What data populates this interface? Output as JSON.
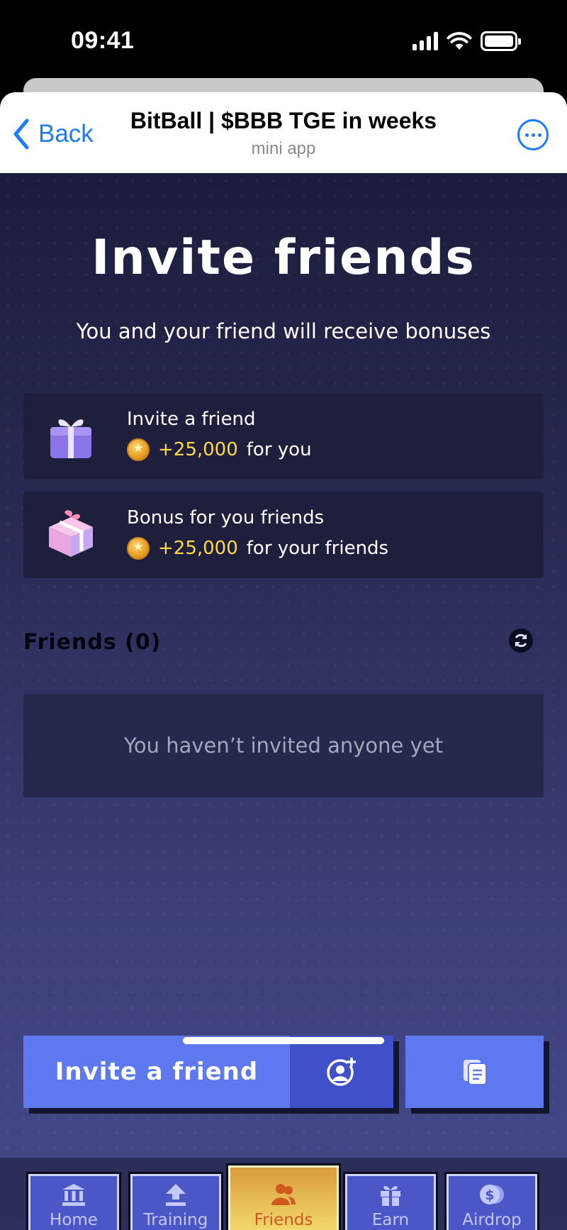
{
  "status_bar": {
    "time": "09:41"
  },
  "header": {
    "back_label": "Back",
    "title": "BitBall | $BBB TGE in weeks",
    "subtitle": "mini app"
  },
  "main": {
    "title": "Invite friends",
    "subtitle": "You and your friend will receive bonuses",
    "bonus_cards": [
      {
        "title": "Invite a friend",
        "amount": "+25,000",
        "suffix": "for you",
        "icon": "gift-box-purple-icon"
      },
      {
        "title": "Bonus for you friends",
        "amount": "+25,000",
        "suffix": "for your friends",
        "icon": "gift-box-pink-icon"
      }
    ],
    "friends_heading": "Friends (0)",
    "empty_text": "You haven’t invited anyone yet"
  },
  "actions": {
    "invite_label": "Invite a friend",
    "invite_icon": "add-user-icon",
    "copy_icon": "copy-icon"
  },
  "nav": {
    "items": [
      {
        "label": "Home",
        "icon": "bank-icon"
      },
      {
        "label": "Training",
        "icon": "upload-icon"
      },
      {
        "label": "Friends",
        "icon": "users-icon",
        "active": true
      },
      {
        "label": "Earn",
        "icon": "gift-icon"
      },
      {
        "label": "Airdrop",
        "icon": "coins-icon"
      }
    ]
  },
  "colors": {
    "accent_blue": "#5e79f0",
    "coin_amount": "#ffd84a",
    "ios_link": "#1b7cf5",
    "active_tab_text": "#d0591f"
  }
}
